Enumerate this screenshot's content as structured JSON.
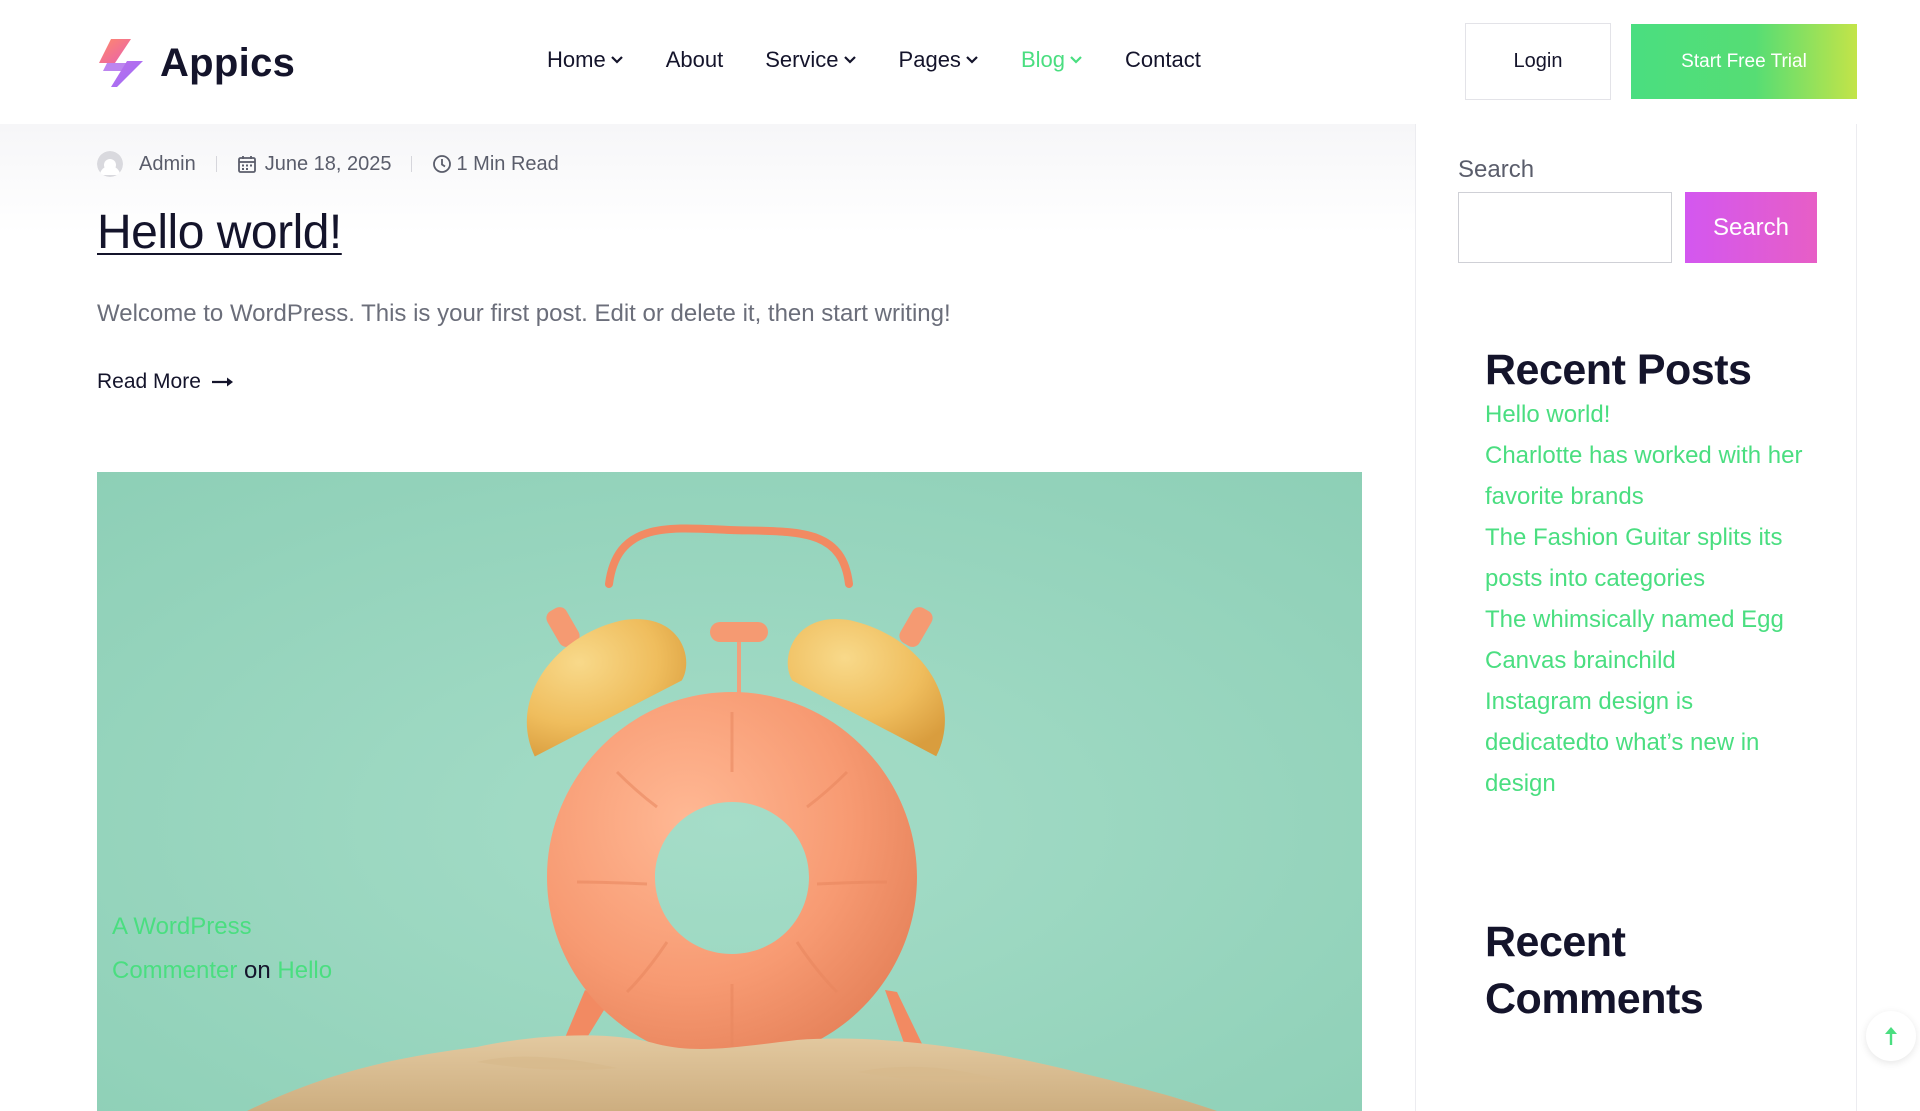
{
  "brand": {
    "name": "Appics"
  },
  "nav": {
    "items": [
      {
        "label": "Home",
        "dropdown": true,
        "active": false
      },
      {
        "label": "About",
        "dropdown": false,
        "active": false
      },
      {
        "label": "Service",
        "dropdown": true,
        "active": false
      },
      {
        "label": "Pages",
        "dropdown": true,
        "active": false
      },
      {
        "label": "Blog",
        "dropdown": true,
        "active": true
      },
      {
        "label": "Contact",
        "dropdown": false,
        "active": false
      }
    ],
    "login_label": "Login",
    "cta_label": "Start Free Trial"
  },
  "post": {
    "author": "Admin",
    "date": "June 18, 2025",
    "read_time": "1 Min Read",
    "title": "Hello world!",
    "excerpt": "Welcome to WordPress. This is your first post. Edit or delete it, then start writing!",
    "read_more_label": "Read More"
  },
  "sidebar": {
    "search": {
      "label": "Search",
      "value": "",
      "button_label": "Search"
    },
    "recent_posts": {
      "title": "Recent Posts",
      "items": [
        "Hello world!",
        "Charlotte has worked with her favorite brands",
        "The Fashion Guitar splits its posts into categories",
        "The whimsically named Egg Canvas brainchild",
        "Instagram design is dedicatedto what’s new in design"
      ]
    },
    "recent_comments": {
      "title": "Recent Comments",
      "author": "A WordPress Commenter",
      "connector": "on",
      "post": "Hello"
    }
  },
  "icons": {
    "nav_chevron": "chevron-down-icon",
    "meta_author": "user-avatar-icon",
    "meta_date": "calendar-icon",
    "meta_read": "clock-icon",
    "read_more": "arrow-right-icon",
    "scroll_top": "arrow-up-icon"
  },
  "colors": {
    "accent_green": "#4ade80",
    "cta_gradient_end": "#c3e448",
    "search_button": "#d357f0",
    "heading": "#14142b",
    "image_background": "#93d3bb"
  }
}
